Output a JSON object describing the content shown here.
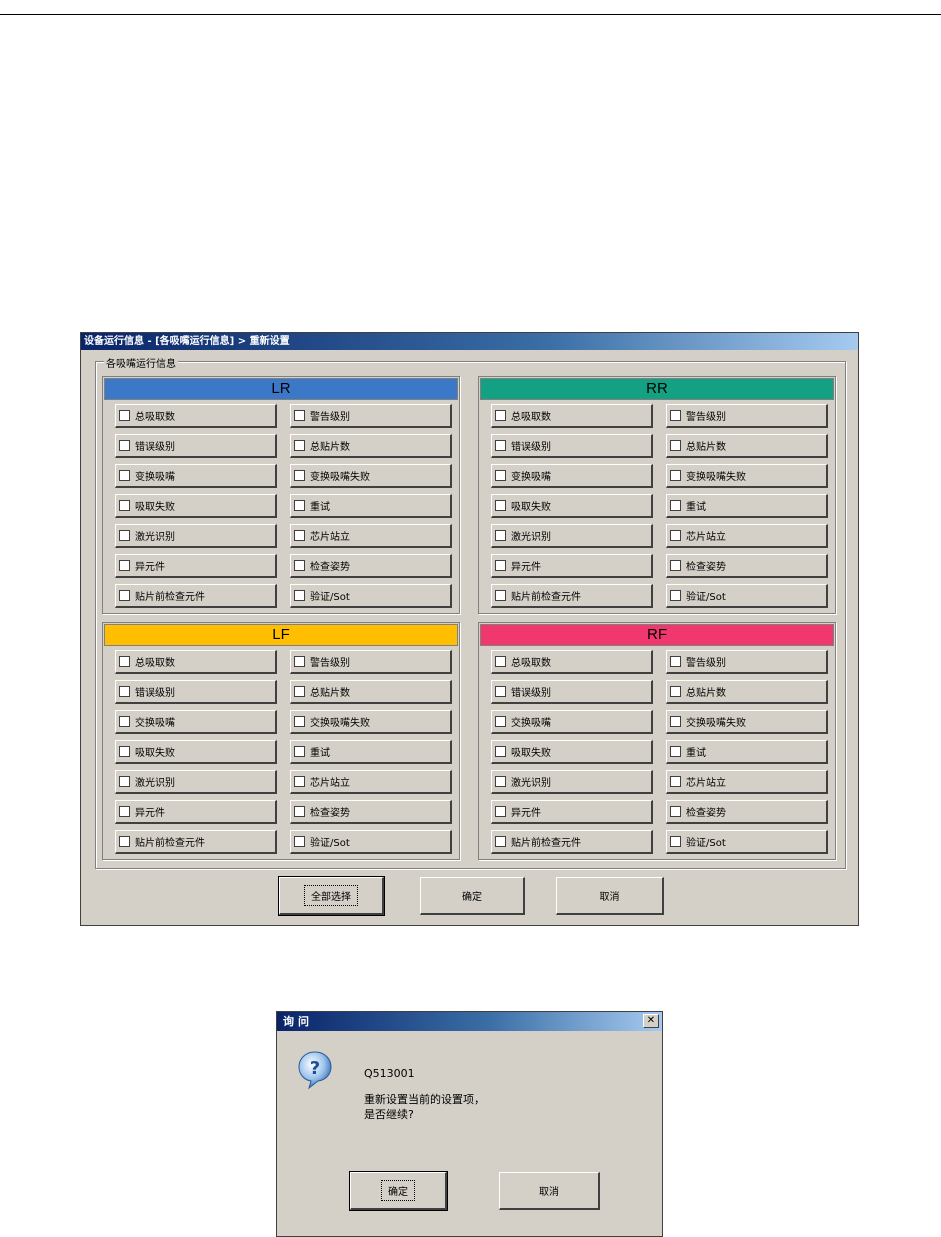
{
  "main_dialog": {
    "title": "设备运行信息 - [各吸嘴运行信息] > 重新设置",
    "group_caption": "各吸嘴运行信息",
    "panels": [
      {
        "name": "LR",
        "color": "#3c78c8",
        "items": [
          "总吸取数",
          "警告级别",
          "错误级别",
          "总贴片数",
          "变换吸嘴",
          "变换吸嘴失败",
          "吸取失败",
          "重试",
          "激光识别",
          "芯片站立",
          "异元件",
          "检查姿势",
          "贴片前检查元件",
          "验证/Sot"
        ]
      },
      {
        "name": "RR",
        "color": "#14a082",
        "items": [
          "总吸取数",
          "警告级别",
          "错误级别",
          "总贴片数",
          "变换吸嘴",
          "变换吸嘴失败",
          "吸取失败",
          "重试",
          "激光识别",
          "芯片站立",
          "异元件",
          "检查姿势",
          "贴片前检查元件",
          "验证/Sot"
        ]
      },
      {
        "name": "LF",
        "color": "#ffbe00",
        "items": [
          "总吸取数",
          "警告级别",
          "错误级别",
          "总贴片数",
          "交换吸嘴",
          "交换吸嘴失败",
          "吸取失败",
          "重试",
          "激光识别",
          "芯片站立",
          "异元件",
          "检查姿势",
          "贴片前检查元件",
          "验证/Sot"
        ]
      },
      {
        "name": "RF",
        "color": "#f0376e",
        "items": [
          "总吸取数",
          "警告级别",
          "错误级别",
          "总贴片数",
          "交换吸嘴",
          "交换吸嘴失败",
          "吸取失败",
          "重试",
          "激光识别",
          "芯片站立",
          "异元件",
          "检查姿势",
          "贴片前检查元件",
          "验证/Sot"
        ]
      }
    ],
    "buttons": {
      "select_all": "全部选择",
      "ok": "确定",
      "cancel": "取消"
    }
  },
  "message_box": {
    "title": "询问",
    "close_glyph": "✕",
    "code": "Q513001",
    "line1": "重新设置当前的设置项，",
    "line2": "是否继续?",
    "ok": "确定",
    "cancel": "取消",
    "icon": "question-icon"
  }
}
